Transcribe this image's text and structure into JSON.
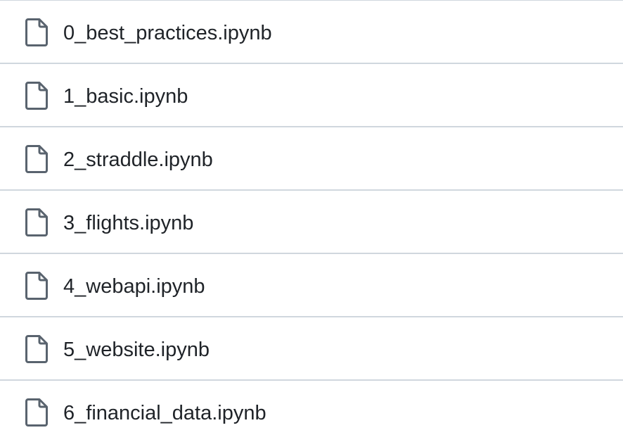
{
  "files": [
    {
      "name": "0_best_practices.ipynb",
      "icon": "file-icon"
    },
    {
      "name": "1_basic.ipynb",
      "icon": "file-icon"
    },
    {
      "name": "2_straddle.ipynb",
      "icon": "file-icon"
    },
    {
      "name": "3_flights.ipynb",
      "icon": "file-icon"
    },
    {
      "name": "4_webapi.ipynb",
      "icon": "file-icon"
    },
    {
      "name": "5_website.ipynb",
      "icon": "file-icon"
    },
    {
      "name": "6_financial_data.ipynb",
      "icon": "file-icon"
    }
  ],
  "colors": {
    "text": "#1f2328",
    "icon": "#59636e",
    "divider": "#d0d7de"
  }
}
